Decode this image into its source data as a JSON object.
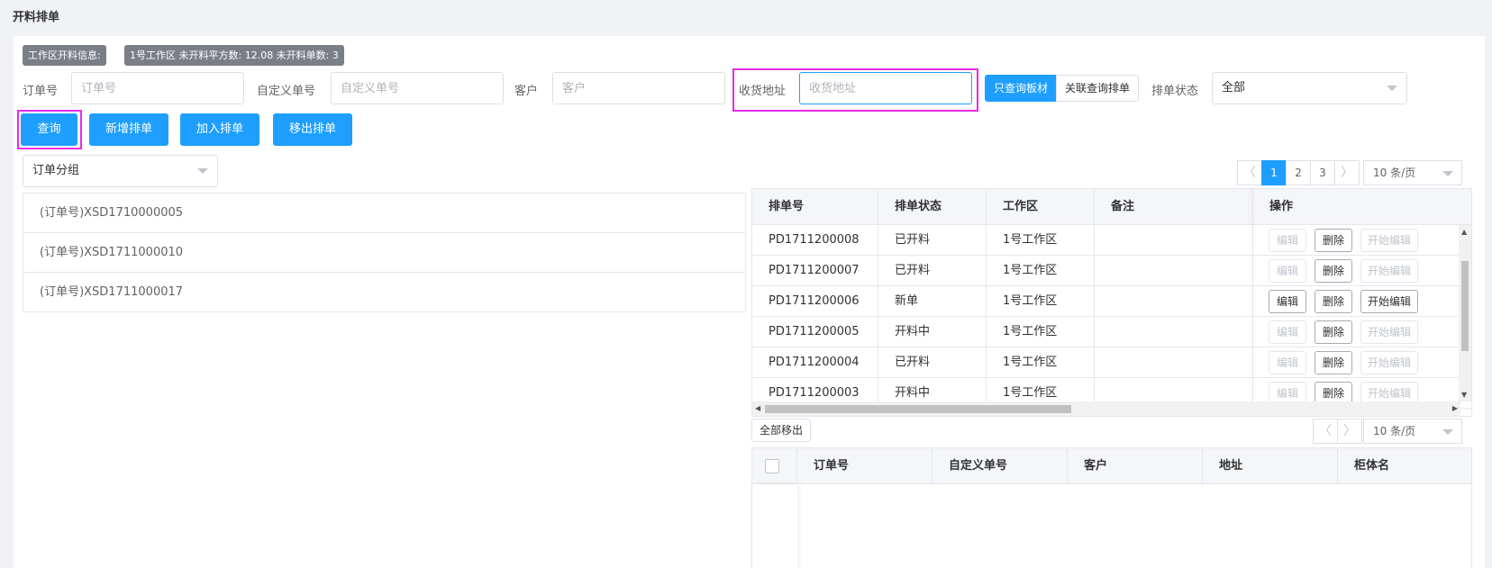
{
  "page_title": "开料排单",
  "tags": {
    "workspace_label": "工作区开料信息:",
    "workspace_info": "1号工作区 未开料平方数: 12.08 未开料单数: 3"
  },
  "filters": {
    "order_no_label": "订单号",
    "order_no_placeholder": "订单号",
    "order_no_value": "",
    "custom_no_label": "自定义单号",
    "custom_no_placeholder": "自定义单号",
    "custom_no_value": "",
    "customer_label": "客户",
    "customer_placeholder": "客户",
    "customer_value": "",
    "address_label": "收货地址",
    "address_placeholder": "收货地址",
    "address_value": "",
    "seg_board": "只查询板材",
    "seg_linked": "关联查询排单",
    "status_label": "排单状态",
    "status_value": "全部"
  },
  "buttons": {
    "query": "查询",
    "new": "新增排单",
    "join": "加入排单",
    "remove": "移出排单"
  },
  "group_select": "订单分组",
  "orders": [
    "(订单号)XSD1710000005",
    "(订单号)XSD1711000010",
    "(订单号)XSD1711000017"
  ],
  "pager_top": {
    "pages": [
      "1",
      "2",
      "3"
    ],
    "active": "1",
    "size": "10 条/页",
    "prev": "〈",
    "next": "〉"
  },
  "schedule_table": {
    "headers": [
      "排单号",
      "排单状态",
      "工作区",
      "备注",
      "操作"
    ],
    "rows": [
      {
        "no": "PD1711200008",
        "status": "已开料",
        "area": "1号工作区",
        "note": "",
        "editable": false
      },
      {
        "no": "PD1711200007",
        "status": "已开料",
        "area": "1号工作区",
        "note": "",
        "editable": false
      },
      {
        "no": "PD1711200006",
        "status": "新单",
        "area": "1号工作区",
        "note": "",
        "editable": true
      },
      {
        "no": "PD1711200005",
        "status": "开料中",
        "area": "1号工作区",
        "note": "",
        "editable": false
      },
      {
        "no": "PD1711200004",
        "status": "已开料",
        "area": "1号工作区",
        "note": "",
        "editable": false
      },
      {
        "no": "PD1711200003",
        "status": "开料中",
        "area": "1号工作区",
        "note": "",
        "editable": false
      }
    ],
    "actions": {
      "edit": "编辑",
      "delete": "删除",
      "start_edit": "开始编辑"
    }
  },
  "remove_all": "全部移出",
  "pager_bottom": {
    "size": "10 条/页",
    "prev": "〈",
    "next": "〉"
  },
  "detail_table": {
    "headers": [
      "订单号",
      "自定义单号",
      "客户",
      "地址",
      "柜体名"
    ]
  },
  "colors": {
    "primary": "#1e9fff",
    "highlight": "#e62ce6",
    "tag": "#7a7f87"
  }
}
